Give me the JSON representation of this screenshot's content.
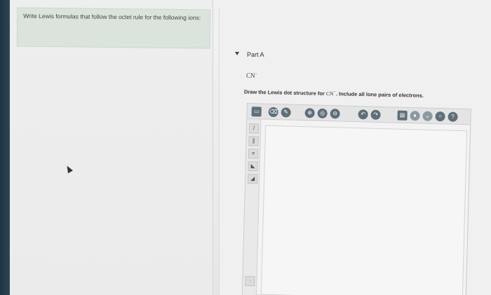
{
  "intro": {
    "text": "Write Lewis formulas that follow the octet rule for the following ions:"
  },
  "part": {
    "title": "Part A",
    "ion": "CN",
    "ion_charge": "−"
  },
  "instruction": {
    "prefix": "Draw the Lewis dot structure for ",
    "ion": "CN",
    "ion_charge": "−",
    "suffix": ". Include all lone pairs of electrons."
  },
  "toolbar": {
    "help_label": "?"
  }
}
